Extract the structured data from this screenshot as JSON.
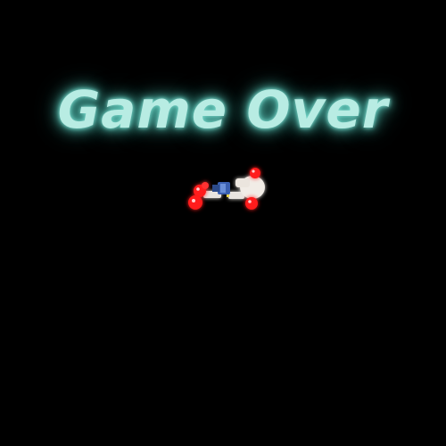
{
  "game_over": {
    "title": "Game Over",
    "title_color": "#b8ece3",
    "glow_color": "#5fc8ba",
    "background": "#000000"
  },
  "player_sprite": {
    "icon": "crashed-character-sprite",
    "state": "knocked-down"
  }
}
